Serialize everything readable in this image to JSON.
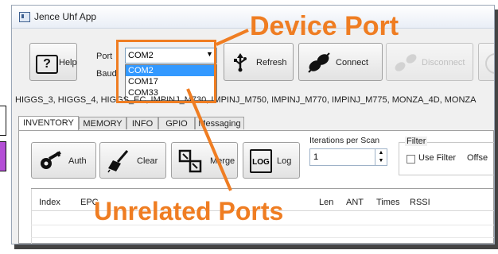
{
  "window": {
    "title": "Jence Uhf App"
  },
  "toolbar": {
    "help_label": "Help",
    "help_glyph": "?",
    "port_label": "Port",
    "baud_label": "Baud",
    "port_value": "COM2",
    "refresh_label": "Refresh",
    "connect_label": "Connect",
    "disconnect_label": "Disconnect"
  },
  "port_dropdown": {
    "options": [
      "COM2",
      "COM17",
      "COM33"
    ],
    "selected_index": 0
  },
  "chips_text": "HIGGS_3, HIGGS_4, HIGGS_EC, IMPINJ_M730, IMPINJ_M750, IMPINJ_M770, IMPINJ_M775, MONZA_4D, MONZA",
  "tabs": [
    "INVENTORY",
    "MEMORY",
    "INFO",
    "GPIO",
    "Messaging"
  ],
  "active_tab": "INVENTORY",
  "inventory": {
    "auth_label": "Auth",
    "clear_label": "Clear",
    "merge_label": "Merge",
    "log_label": "Log",
    "log_glyph": "LOG",
    "iterations_label": "Iterations per Scan",
    "iterations_value": "1",
    "filter_label": "Filter",
    "use_filter_label": "Use Filter",
    "offset_label": "Offse"
  },
  "table": {
    "columns": [
      "Index",
      "EPC",
      "Len",
      "ANT",
      "Times",
      "RSSI"
    ]
  },
  "annotations": {
    "device_port": "Device Port",
    "unrelated_ports": "Unrelated Ports"
  },
  "colors": {
    "annotation": "#ef7d22",
    "selection": "#3399ff",
    "sliver_accent": "#b44fd6"
  }
}
